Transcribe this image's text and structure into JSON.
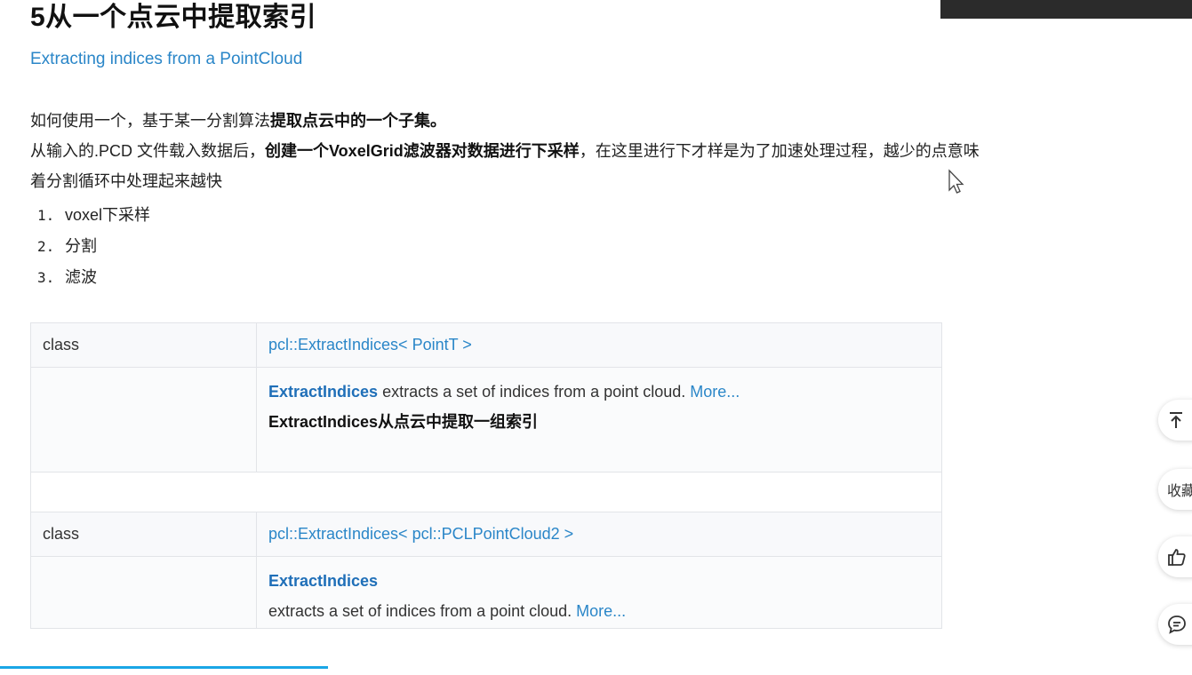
{
  "article": {
    "title": "5从一个点云中提取索引",
    "subtitle": "Extracting indices from a PointCloud",
    "para1_normal": "如何使用一个，基于某一分割算法",
    "para1_bold": "提取点云中的一个子集。",
    "para2_normal_a": "从输入的.PCD 文件载入数据后，",
    "para2_bold": "创建一个VoxelGrid滤波器对数据进行下采样",
    "para2_normal_b": "，在这里进行下才样是为了加速处理过程，越少的点意味",
    "para3": "着分割循环中处理起来越快",
    "list": [
      {
        "num": "1.",
        "text": "voxel下采样"
      },
      {
        "num": "2.",
        "text": "分割"
      },
      {
        "num": "3.",
        "text": "滤波"
      }
    ]
  },
  "table": {
    "rows": [
      {
        "kind": "class",
        "signature": "pcl::ExtractIndices< PointT >",
        "name_link": "ExtractIndices",
        "desc": " extracts a set of indices from a point cloud. ",
        "more": "More...",
        "zh": "ExtractIndices从点云中提取一组索引"
      },
      {
        "kind": "class",
        "signature": "pcl::ExtractIndices< pcl::PCLPointCloud2 >",
        "name_link": "ExtractIndices",
        "desc": " extracts a set of indices from a point cloud. ",
        "more": "More..."
      }
    ]
  },
  "sidebar": {
    "top_icon": "arrow-to-top-icon",
    "collect_label": "收藏",
    "like_icon": "thumbs-up-icon",
    "comment_icon": "comment-icon"
  },
  "colors": {
    "link": "#2a86c8",
    "link_bold": "#1f6fb8",
    "progress": "#1aa6e6"
  },
  "reading_progress": 0.275
}
